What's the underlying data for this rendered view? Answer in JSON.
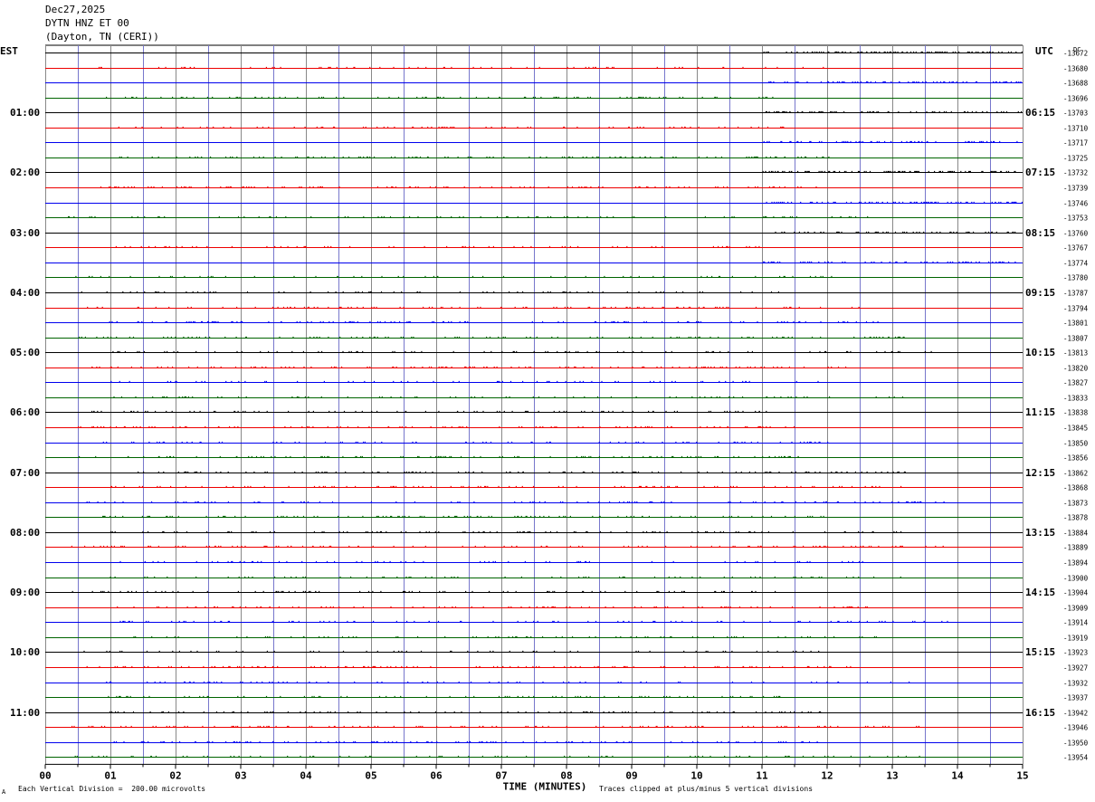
{
  "header": {
    "date": "Dec27,2025",
    "station": "DYTN HNZ ET 00",
    "location": "(Dayton, TN (CERI))"
  },
  "footer": {
    "scale_note": "Each Vertical Division =  200.00 microvolts",
    "clip_note": "Traces clipped at plus/minus 5 vertical divisions",
    "corner_mark": "A"
  },
  "chart_data": {
    "type": "line",
    "title": "",
    "xlabel": "TIME (MINUTES)",
    "ylabel_left": "EST",
    "ylabel_right": "UTC",
    "dc_label": "DC",
    "xlim": [
      0,
      15
    ],
    "x_ticks": [
      "00",
      "01",
      "02",
      "03",
      "04",
      "05",
      "06",
      "07",
      "08",
      "09",
      "10",
      "11",
      "12",
      "13",
      "14",
      "15"
    ],
    "grid": true,
    "trace_colors": [
      "#000000",
      "#ee0000",
      "#0000ee",
      "#006400"
    ],
    "left_hour_labels": [
      "01:00",
      "02:00",
      "03:00",
      "04:00",
      "05:00",
      "06:00",
      "07:00",
      "08:00",
      "09:00",
      "10:00",
      "11:00"
    ],
    "right_hour_labels": [
      "06:15",
      "07:15",
      "08:15",
      "09:15",
      "10:15",
      "11:15",
      "12:15",
      "13:15",
      "14:15",
      "15:15",
      "16:15"
    ],
    "dc_offsets": [
      "-13672",
      "-13680",
      "-13688",
      "-13696",
      "-13703",
      "-13710",
      "-13717",
      "-13725",
      "-13732",
      "-13739",
      "-13746",
      "-13753",
      "-13760",
      "-13767",
      "-13774",
      "-13780",
      "-13787",
      "-13794",
      "-13801",
      "-13807",
      "-13813",
      "-13820",
      "-13827",
      "-13833",
      "-13838",
      "-13845",
      "-13850",
      "-13856",
      "-13862",
      "-13868",
      "-13873",
      "-13878",
      "-13884",
      "-13889",
      "-13894",
      "-13900",
      "-13904",
      "-13909",
      "-13914",
      "-13919",
      "-13923",
      "-13927",
      "-13932",
      "-13937",
      "-13942",
      "-13946",
      "-13950",
      "-13954"
    ]
  }
}
